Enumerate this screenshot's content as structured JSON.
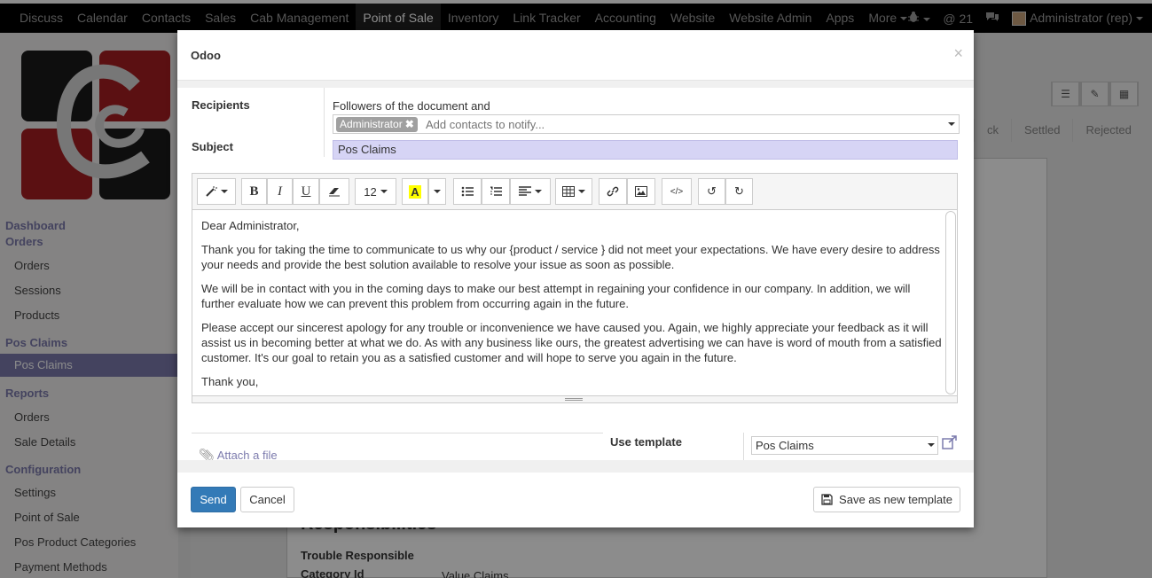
{
  "topnav": {
    "items": [
      "Discuss",
      "Calendar",
      "Contacts",
      "Sales",
      "Cab Management",
      "Point of Sale",
      "Inventory",
      "Link Tracker",
      "Accounting",
      "Website",
      "Website Admin",
      "Apps",
      "More"
    ],
    "active_index": 5,
    "message_count": "21",
    "user": "Administrator (rep)"
  },
  "sidebar": {
    "dashboard": "Dashboard",
    "orders_head": "Orders",
    "orders_items": [
      "Orders",
      "Sessions",
      "Products"
    ],
    "claims_head": "Pos Claims",
    "claims_item": "Pos Claims",
    "reports_head": "Reports",
    "reports_items": [
      "Orders",
      "Sale Details"
    ],
    "config_head": "Configuration",
    "config_items": [
      "Settings",
      "Point of Sale",
      "Pos Product Categories",
      "Payment Methods"
    ]
  },
  "background": {
    "statuses": [
      "ck",
      "Settled",
      "Rejected"
    ],
    "responsibilities": "Responsibilities",
    "trouble_label": "Trouble Responsible",
    "category_label": "Category Id",
    "category_value": "Value Claims"
  },
  "dialog": {
    "title": "Odoo",
    "close": "×",
    "recipients_label": "Recipients",
    "followers_text": "Followers of the document and",
    "recipient_tag": "Administrator",
    "recipient_placeholder": "Add contacts to notify...",
    "subject_label": "Subject",
    "subject_value": "Pos Claims",
    "font_size": "12",
    "body": [
      "Dear Administrator,",
      "Thank you for taking the time to communicate to us why our {product / service } did not meet your expectations. We have every desire to address your needs and provide the best solution available to resolve your issue as soon as possible.",
      "We will be in contact with you in the coming days to make our best attempt in regaining your confidence in our company. In addition, we will further evaluate how we can prevent this problem from occurring again in the future.",
      "Please accept our sincerest apology for any trouble or inconvenience we have caused you. Again, we highly appreciate your feedback as it will assist us in becoming better at what we do. As with any business like ours, the greatest advertising we can have is word of mouth from a satisfied customer. It's our goal to retain you as a satisfied customer and will hope to serve you again in the future.",
      "Thank you,"
    ],
    "attach_label": "Attach a file",
    "template_label": "Use template",
    "template_value": "Pos Claims",
    "send_label": "Send",
    "cancel_label": "Cancel",
    "save_template_label": "Save as new template"
  },
  "colors": {
    "brand": "#7c7bad",
    "primary": "#337ab7",
    "subject_bg": "#d6d4f5"
  }
}
